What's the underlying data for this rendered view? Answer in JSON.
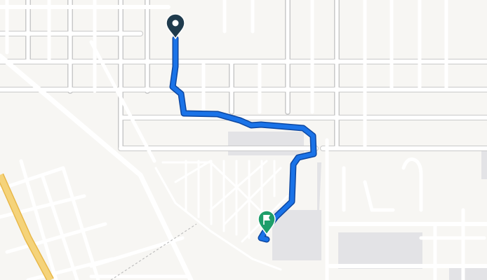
{
  "map": {
    "background_color": "#f7f6f3",
    "road_color": "#ffffff",
    "road_casing_color": "#c9c9c9",
    "highway_color": "#f5d37a",
    "building_color": "#e2e2e4",
    "route_color": "#1a73e8",
    "route_casing_color": "#0d47a1"
  },
  "markers": {
    "start": {
      "icon": "location-pin-icon",
      "color": "#1f3b4d"
    },
    "destination": {
      "icon": "flag-pin-icon",
      "color": "#1e9e6a"
    }
  }
}
